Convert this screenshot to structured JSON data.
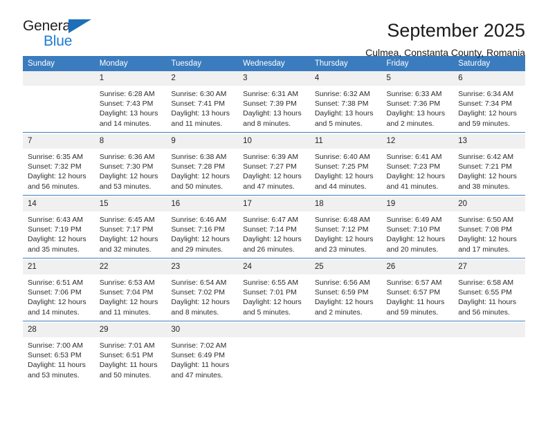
{
  "brand": {
    "name_part1": "General",
    "name_part2": "Blue",
    "triangle_color": "#1c6fb8",
    "blue_color": "#1c7ad4"
  },
  "header": {
    "title": "September 2025",
    "location": "Culmea, Constanta County, Romania"
  },
  "theme": {
    "header_blue": "#3a7cbe",
    "daynum_band": "#f0f0f0",
    "text": "#222222"
  },
  "weekdays": [
    "Sunday",
    "Monday",
    "Tuesday",
    "Wednesday",
    "Thursday",
    "Friday",
    "Saturday"
  ],
  "weeks": [
    [
      {
        "day": "",
        "sunrise": "",
        "sunset": "",
        "daylight1": "",
        "daylight2": ""
      },
      {
        "day": "1",
        "sunrise": "Sunrise: 6:28 AM",
        "sunset": "Sunset: 7:43 PM",
        "daylight1": "Daylight: 13 hours",
        "daylight2": "and 14 minutes."
      },
      {
        "day": "2",
        "sunrise": "Sunrise: 6:30 AM",
        "sunset": "Sunset: 7:41 PM",
        "daylight1": "Daylight: 13 hours",
        "daylight2": "and 11 minutes."
      },
      {
        "day": "3",
        "sunrise": "Sunrise: 6:31 AM",
        "sunset": "Sunset: 7:39 PM",
        "daylight1": "Daylight: 13 hours",
        "daylight2": "and 8 minutes."
      },
      {
        "day": "4",
        "sunrise": "Sunrise: 6:32 AM",
        "sunset": "Sunset: 7:38 PM",
        "daylight1": "Daylight: 13 hours",
        "daylight2": "and 5 minutes."
      },
      {
        "day": "5",
        "sunrise": "Sunrise: 6:33 AM",
        "sunset": "Sunset: 7:36 PM",
        "daylight1": "Daylight: 13 hours",
        "daylight2": "and 2 minutes."
      },
      {
        "day": "6",
        "sunrise": "Sunrise: 6:34 AM",
        "sunset": "Sunset: 7:34 PM",
        "daylight1": "Daylight: 12 hours",
        "daylight2": "and 59 minutes."
      }
    ],
    [
      {
        "day": "7",
        "sunrise": "Sunrise: 6:35 AM",
        "sunset": "Sunset: 7:32 PM",
        "daylight1": "Daylight: 12 hours",
        "daylight2": "and 56 minutes."
      },
      {
        "day": "8",
        "sunrise": "Sunrise: 6:36 AM",
        "sunset": "Sunset: 7:30 PM",
        "daylight1": "Daylight: 12 hours",
        "daylight2": "and 53 minutes."
      },
      {
        "day": "9",
        "sunrise": "Sunrise: 6:38 AM",
        "sunset": "Sunset: 7:28 PM",
        "daylight1": "Daylight: 12 hours",
        "daylight2": "and 50 minutes."
      },
      {
        "day": "10",
        "sunrise": "Sunrise: 6:39 AM",
        "sunset": "Sunset: 7:27 PM",
        "daylight1": "Daylight: 12 hours",
        "daylight2": "and 47 minutes."
      },
      {
        "day": "11",
        "sunrise": "Sunrise: 6:40 AM",
        "sunset": "Sunset: 7:25 PM",
        "daylight1": "Daylight: 12 hours",
        "daylight2": "and 44 minutes."
      },
      {
        "day": "12",
        "sunrise": "Sunrise: 6:41 AM",
        "sunset": "Sunset: 7:23 PM",
        "daylight1": "Daylight: 12 hours",
        "daylight2": "and 41 minutes."
      },
      {
        "day": "13",
        "sunrise": "Sunrise: 6:42 AM",
        "sunset": "Sunset: 7:21 PM",
        "daylight1": "Daylight: 12 hours",
        "daylight2": "and 38 minutes."
      }
    ],
    [
      {
        "day": "14",
        "sunrise": "Sunrise: 6:43 AM",
        "sunset": "Sunset: 7:19 PM",
        "daylight1": "Daylight: 12 hours",
        "daylight2": "and 35 minutes."
      },
      {
        "day": "15",
        "sunrise": "Sunrise: 6:45 AM",
        "sunset": "Sunset: 7:17 PM",
        "daylight1": "Daylight: 12 hours",
        "daylight2": "and 32 minutes."
      },
      {
        "day": "16",
        "sunrise": "Sunrise: 6:46 AM",
        "sunset": "Sunset: 7:16 PM",
        "daylight1": "Daylight: 12 hours",
        "daylight2": "and 29 minutes."
      },
      {
        "day": "17",
        "sunrise": "Sunrise: 6:47 AM",
        "sunset": "Sunset: 7:14 PM",
        "daylight1": "Daylight: 12 hours",
        "daylight2": "and 26 minutes."
      },
      {
        "day": "18",
        "sunrise": "Sunrise: 6:48 AM",
        "sunset": "Sunset: 7:12 PM",
        "daylight1": "Daylight: 12 hours",
        "daylight2": "and 23 minutes."
      },
      {
        "day": "19",
        "sunrise": "Sunrise: 6:49 AM",
        "sunset": "Sunset: 7:10 PM",
        "daylight1": "Daylight: 12 hours",
        "daylight2": "and 20 minutes."
      },
      {
        "day": "20",
        "sunrise": "Sunrise: 6:50 AM",
        "sunset": "Sunset: 7:08 PM",
        "daylight1": "Daylight: 12 hours",
        "daylight2": "and 17 minutes."
      }
    ],
    [
      {
        "day": "21",
        "sunrise": "Sunrise: 6:51 AM",
        "sunset": "Sunset: 7:06 PM",
        "daylight1": "Daylight: 12 hours",
        "daylight2": "and 14 minutes."
      },
      {
        "day": "22",
        "sunrise": "Sunrise: 6:53 AM",
        "sunset": "Sunset: 7:04 PM",
        "daylight1": "Daylight: 12 hours",
        "daylight2": "and 11 minutes."
      },
      {
        "day": "23",
        "sunrise": "Sunrise: 6:54 AM",
        "sunset": "Sunset: 7:02 PM",
        "daylight1": "Daylight: 12 hours",
        "daylight2": "and 8 minutes."
      },
      {
        "day": "24",
        "sunrise": "Sunrise: 6:55 AM",
        "sunset": "Sunset: 7:01 PM",
        "daylight1": "Daylight: 12 hours",
        "daylight2": "and 5 minutes."
      },
      {
        "day": "25",
        "sunrise": "Sunrise: 6:56 AM",
        "sunset": "Sunset: 6:59 PM",
        "daylight1": "Daylight: 12 hours",
        "daylight2": "and 2 minutes."
      },
      {
        "day": "26",
        "sunrise": "Sunrise: 6:57 AM",
        "sunset": "Sunset: 6:57 PM",
        "daylight1": "Daylight: 11 hours",
        "daylight2": "and 59 minutes."
      },
      {
        "day": "27",
        "sunrise": "Sunrise: 6:58 AM",
        "sunset": "Sunset: 6:55 PM",
        "daylight1": "Daylight: 11 hours",
        "daylight2": "and 56 minutes."
      }
    ],
    [
      {
        "day": "28",
        "sunrise": "Sunrise: 7:00 AM",
        "sunset": "Sunset: 6:53 PM",
        "daylight1": "Daylight: 11 hours",
        "daylight2": "and 53 minutes."
      },
      {
        "day": "29",
        "sunrise": "Sunrise: 7:01 AM",
        "sunset": "Sunset: 6:51 PM",
        "daylight1": "Daylight: 11 hours",
        "daylight2": "and 50 minutes."
      },
      {
        "day": "30",
        "sunrise": "Sunrise: 7:02 AM",
        "sunset": "Sunset: 6:49 PM",
        "daylight1": "Daylight: 11 hours",
        "daylight2": "and 47 minutes."
      },
      {
        "day": "",
        "sunrise": "",
        "sunset": "",
        "daylight1": "",
        "daylight2": ""
      },
      {
        "day": "",
        "sunrise": "",
        "sunset": "",
        "daylight1": "",
        "daylight2": ""
      },
      {
        "day": "",
        "sunrise": "",
        "sunset": "",
        "daylight1": "",
        "daylight2": ""
      },
      {
        "day": "",
        "sunrise": "",
        "sunset": "",
        "daylight1": "",
        "daylight2": ""
      }
    ]
  ]
}
